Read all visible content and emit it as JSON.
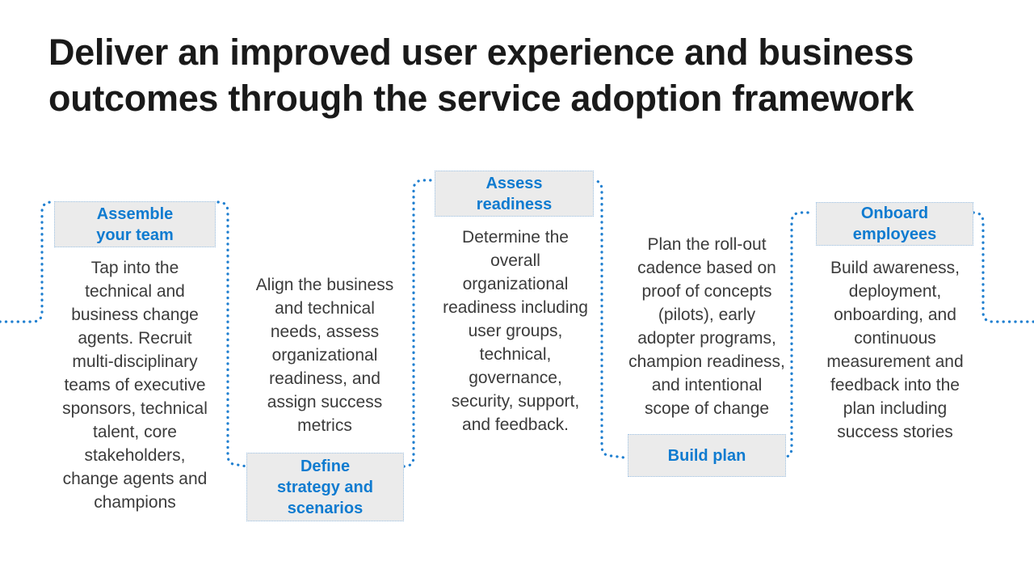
{
  "slide": {
    "title": "Deliver an improved user experience and business\noutcomes through the service adoption framework",
    "background_color": "#ffffff",
    "accent_color": "#0f7bd0",
    "header_fill_color": "#ebebeb",
    "header_border_color": "#9dc3e6",
    "body_text_color": "#3b3b3b",
    "title_text_color": "#1a1a1a",
    "connector_color": "#1f7fd0",
    "connector_style": "dotted"
  },
  "stages": [
    {
      "id": "assemble-your-team",
      "header": "Assemble\nyour team",
      "header_position": "top",
      "body": "Tap into the\ntechnical and\nbusiness change\nagents. Recruit\nmulti-disciplinary\nteams of executive\nsponsors, technical\ntalent, core\nstakeholders,\nchange agents and\nchampions"
    },
    {
      "id": "define-strategy-and-scenarios",
      "header": "Define\nstrategy and\nscenarios",
      "header_position": "bottom",
      "body": "Align the business\nand technical\nneeds, assess\norganizational\nreadiness, and\nassign success\nmetrics"
    },
    {
      "id": "assess-readiness",
      "header": "Assess\nreadiness",
      "header_position": "top",
      "body": "Determine the\noverall\norganizational\nreadiness including\nuser groups,\ntechnical,\ngovernance,\nsecurity, support,\nand feedback."
    },
    {
      "id": "build-plan",
      "header": "Build plan",
      "header_position": "bottom",
      "body": "Plan the roll-out\ncadence based on\nproof of concepts\n(pilots), early\nadopter programs,\nchampion readiness,\nand intentional\nscope of change"
    },
    {
      "id": "onboard-employees",
      "header": "Onboard\nemployees",
      "header_position": "top",
      "body": "Build awareness,\ndeployment,\nonboarding, and\ncontinuous\nmeasurement and\nfeedback into the\nplan including\nsuccess stories"
    }
  ]
}
